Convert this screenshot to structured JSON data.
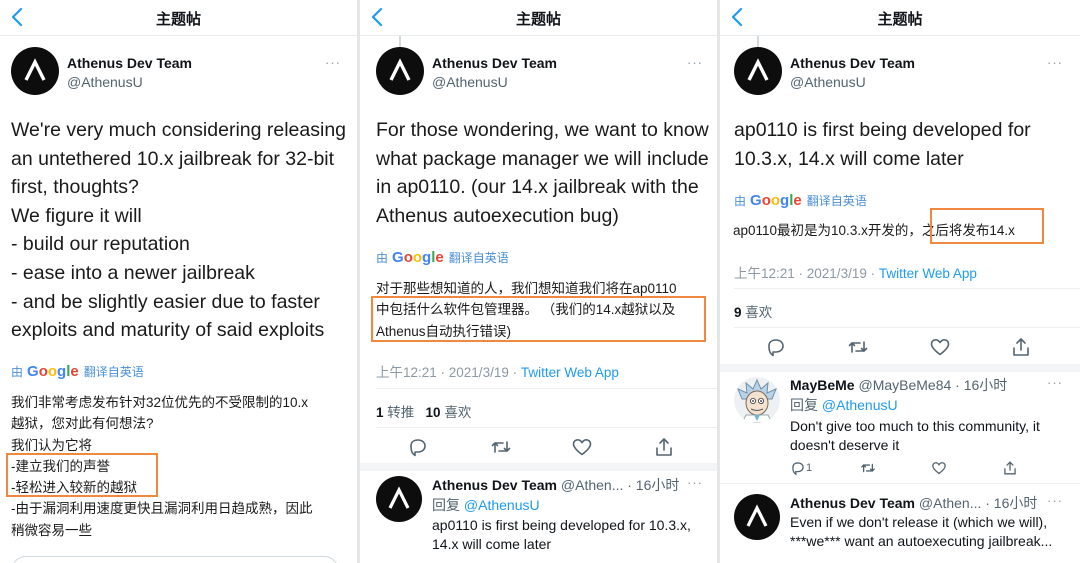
{
  "header_title": "主题帖",
  "colors": {
    "accent": "#1d9bf0",
    "highlight": "#f0883e",
    "avatar_bg": "#0d0d0d"
  },
  "icons": [
    "chevron-left-icon",
    "athenus-logo-icon",
    "more-icon",
    "translate-icon",
    "google-logo",
    "reply-icon",
    "retweet-icon",
    "like-icon",
    "share-icon"
  ],
  "panel1": {
    "author_name": "Athenus Dev Team",
    "author_handle": "@AthenusU",
    "more": "···",
    "text_lines": [
      "We're very much considering releasing",
      "an untethered 10.x jailbreak for 32-bit",
      "first, thoughts?",
      "We figure it will",
      "- build our reputation",
      "- ease into a newer jailbreak",
      "- and be slightly easier due to faster",
      "exploits and maturity of said exploits"
    ],
    "translate_icon": "由",
    "google_label": "Google",
    "translated_from": "翻译自英语",
    "zh_lines": [
      "我们非常考虑发布针对32位优先的不受限制的10.x",
      "越狱，您对此有何想法?",
      "我们认为它将",
      "-建立我们的声誉",
      "-轻松进入较新的越狱",
      "-由于漏洞利用速度更快且漏洞利用日趋成熟，因此",
      "稍微容易一些"
    ]
  },
  "panel2": {
    "author_name": "Athenus Dev Team",
    "author_handle": "@AthenusU",
    "more": "···",
    "text_lines": [
      "For those wondering, we want to know",
      "what package manager we will include",
      "in ap0110. (our 14.x jailbreak with the",
      "Athenus autoexecution bug)"
    ],
    "translate_icon": "由",
    "google_label": "Google",
    "translated_from": "翻译自英语",
    "zh_lines": [
      "对于那些想知道的人，我们想知道我们将在ap0110",
      "中包括什么软件包管理器。 （我们的14.x越狱以及",
      "Athenus自动执行错误)"
    ],
    "time": "上午12:21 · 2021/3/19 · ",
    "app": "Twitter Web App",
    "retweets_count": "1",
    "retweets_label": " 转推",
    "likes_count": "10",
    "likes_label": " 喜欢",
    "reply": {
      "name": "Athenus Dev Team",
      "handle_time": " @Athen... · 16小时",
      "more": "···",
      "replying_label": "回复 ",
      "replying_to": "@AthenusU",
      "text_lines": [
        "ap0110 is first being developed for 10.3.x,",
        "14.x will come later"
      ]
    }
  },
  "panel3": {
    "author_name": "Athenus Dev Team",
    "author_handle": "@AthenusU",
    "more": "···",
    "text_lines": [
      "ap0110 is first being developed for",
      "10.3.x, 14.x will come later"
    ],
    "translate_icon": "由",
    "google_label": "Google",
    "translated_from": "翻译自英语",
    "zh_before": "ap0110最初是为10.3.x开发的，",
    "zh_highlight": "之后将发布14.x",
    "time": "上午12:21 · 2021/3/19 · ",
    "app": "Twitter Web App",
    "likes_count": "9",
    "likes_label": " 喜欢",
    "replies": [
      {
        "name": "MayBeMe",
        "handle_time": " @MayBeMe84 · 16小时",
        "more": "···",
        "replying_label": "回复 ",
        "replying_to": "@AthenusU",
        "text_lines": [
          "Don't give too much to this community, it",
          "doesn't deserve it"
        ],
        "reply_count": "1"
      },
      {
        "name": "Athenus Dev Team",
        "handle_time": " @Athen... · 16小时",
        "more": "···",
        "text_lines": [
          "Even if we don't release it (which we will),",
          "***we*** want an autoexecuting jailbreak..."
        ]
      }
    ]
  }
}
